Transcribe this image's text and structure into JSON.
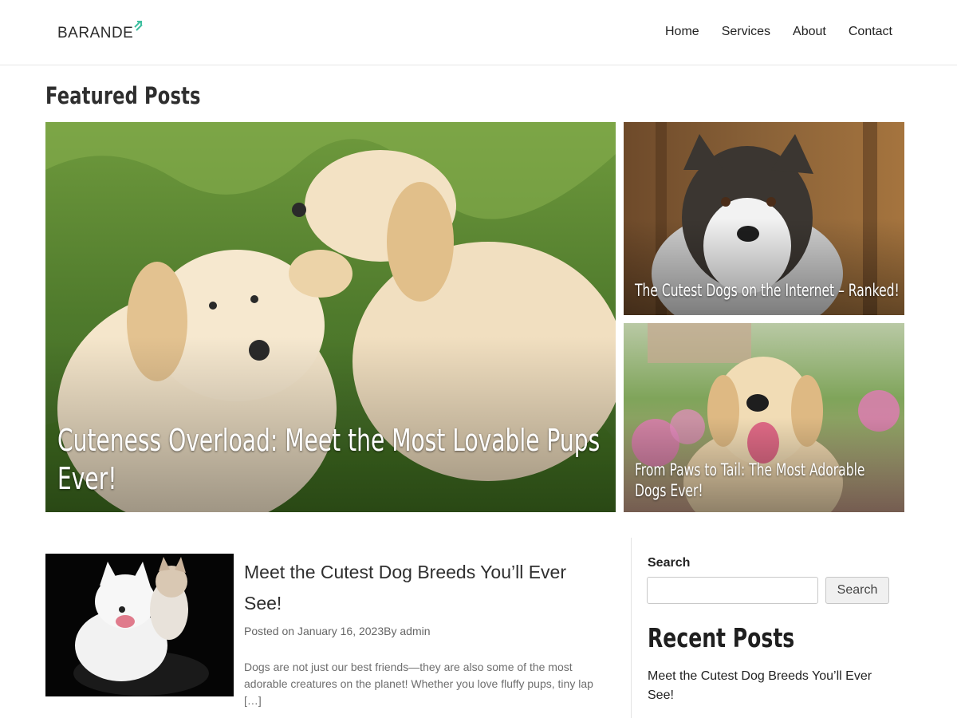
{
  "site": {
    "logo_text": "BARANDE",
    "brand_color": "#3dbf9f"
  },
  "nav": {
    "items": [
      {
        "label": "Home"
      },
      {
        "label": "Services"
      },
      {
        "label": "About"
      },
      {
        "label": "Contact"
      }
    ]
  },
  "featured": {
    "title": "Featured Posts",
    "posts": [
      {
        "title": "Cuteness Overload: Meet the Most Lovable Pups Ever!",
        "image": "two golden retriever puppies in grass"
      },
      {
        "title": "The Cutest Dogs on the Internet – Ranked!",
        "image": "alaskan malamute in forest"
      },
      {
        "title": "From Paws to Tail: The Most Adorable Dogs Ever!",
        "image": "golden retriever in garden with flowers"
      }
    ]
  },
  "posts": [
    {
      "title": "Meet the Cutest Dog Breeds You’ll Ever See!",
      "meta_prefix": "Posted on ",
      "date": "January 16, 2023",
      "by_label": "By ",
      "author": "admin",
      "excerpt": "Dogs are not just our best friends—they are also some of the most adorable creatures on the planet! Whether you love fluffy pups, tiny lap […]",
      "image": "white spitz dog and puppy on black cushion"
    }
  ],
  "sidebar": {
    "search_label": "Search",
    "search_placeholder": "",
    "search_button": "Search",
    "recent_title": "Recent Posts",
    "recent_posts": [
      {
        "title": "Meet the Cutest Dog Breeds You’ll Ever See!"
      }
    ]
  }
}
